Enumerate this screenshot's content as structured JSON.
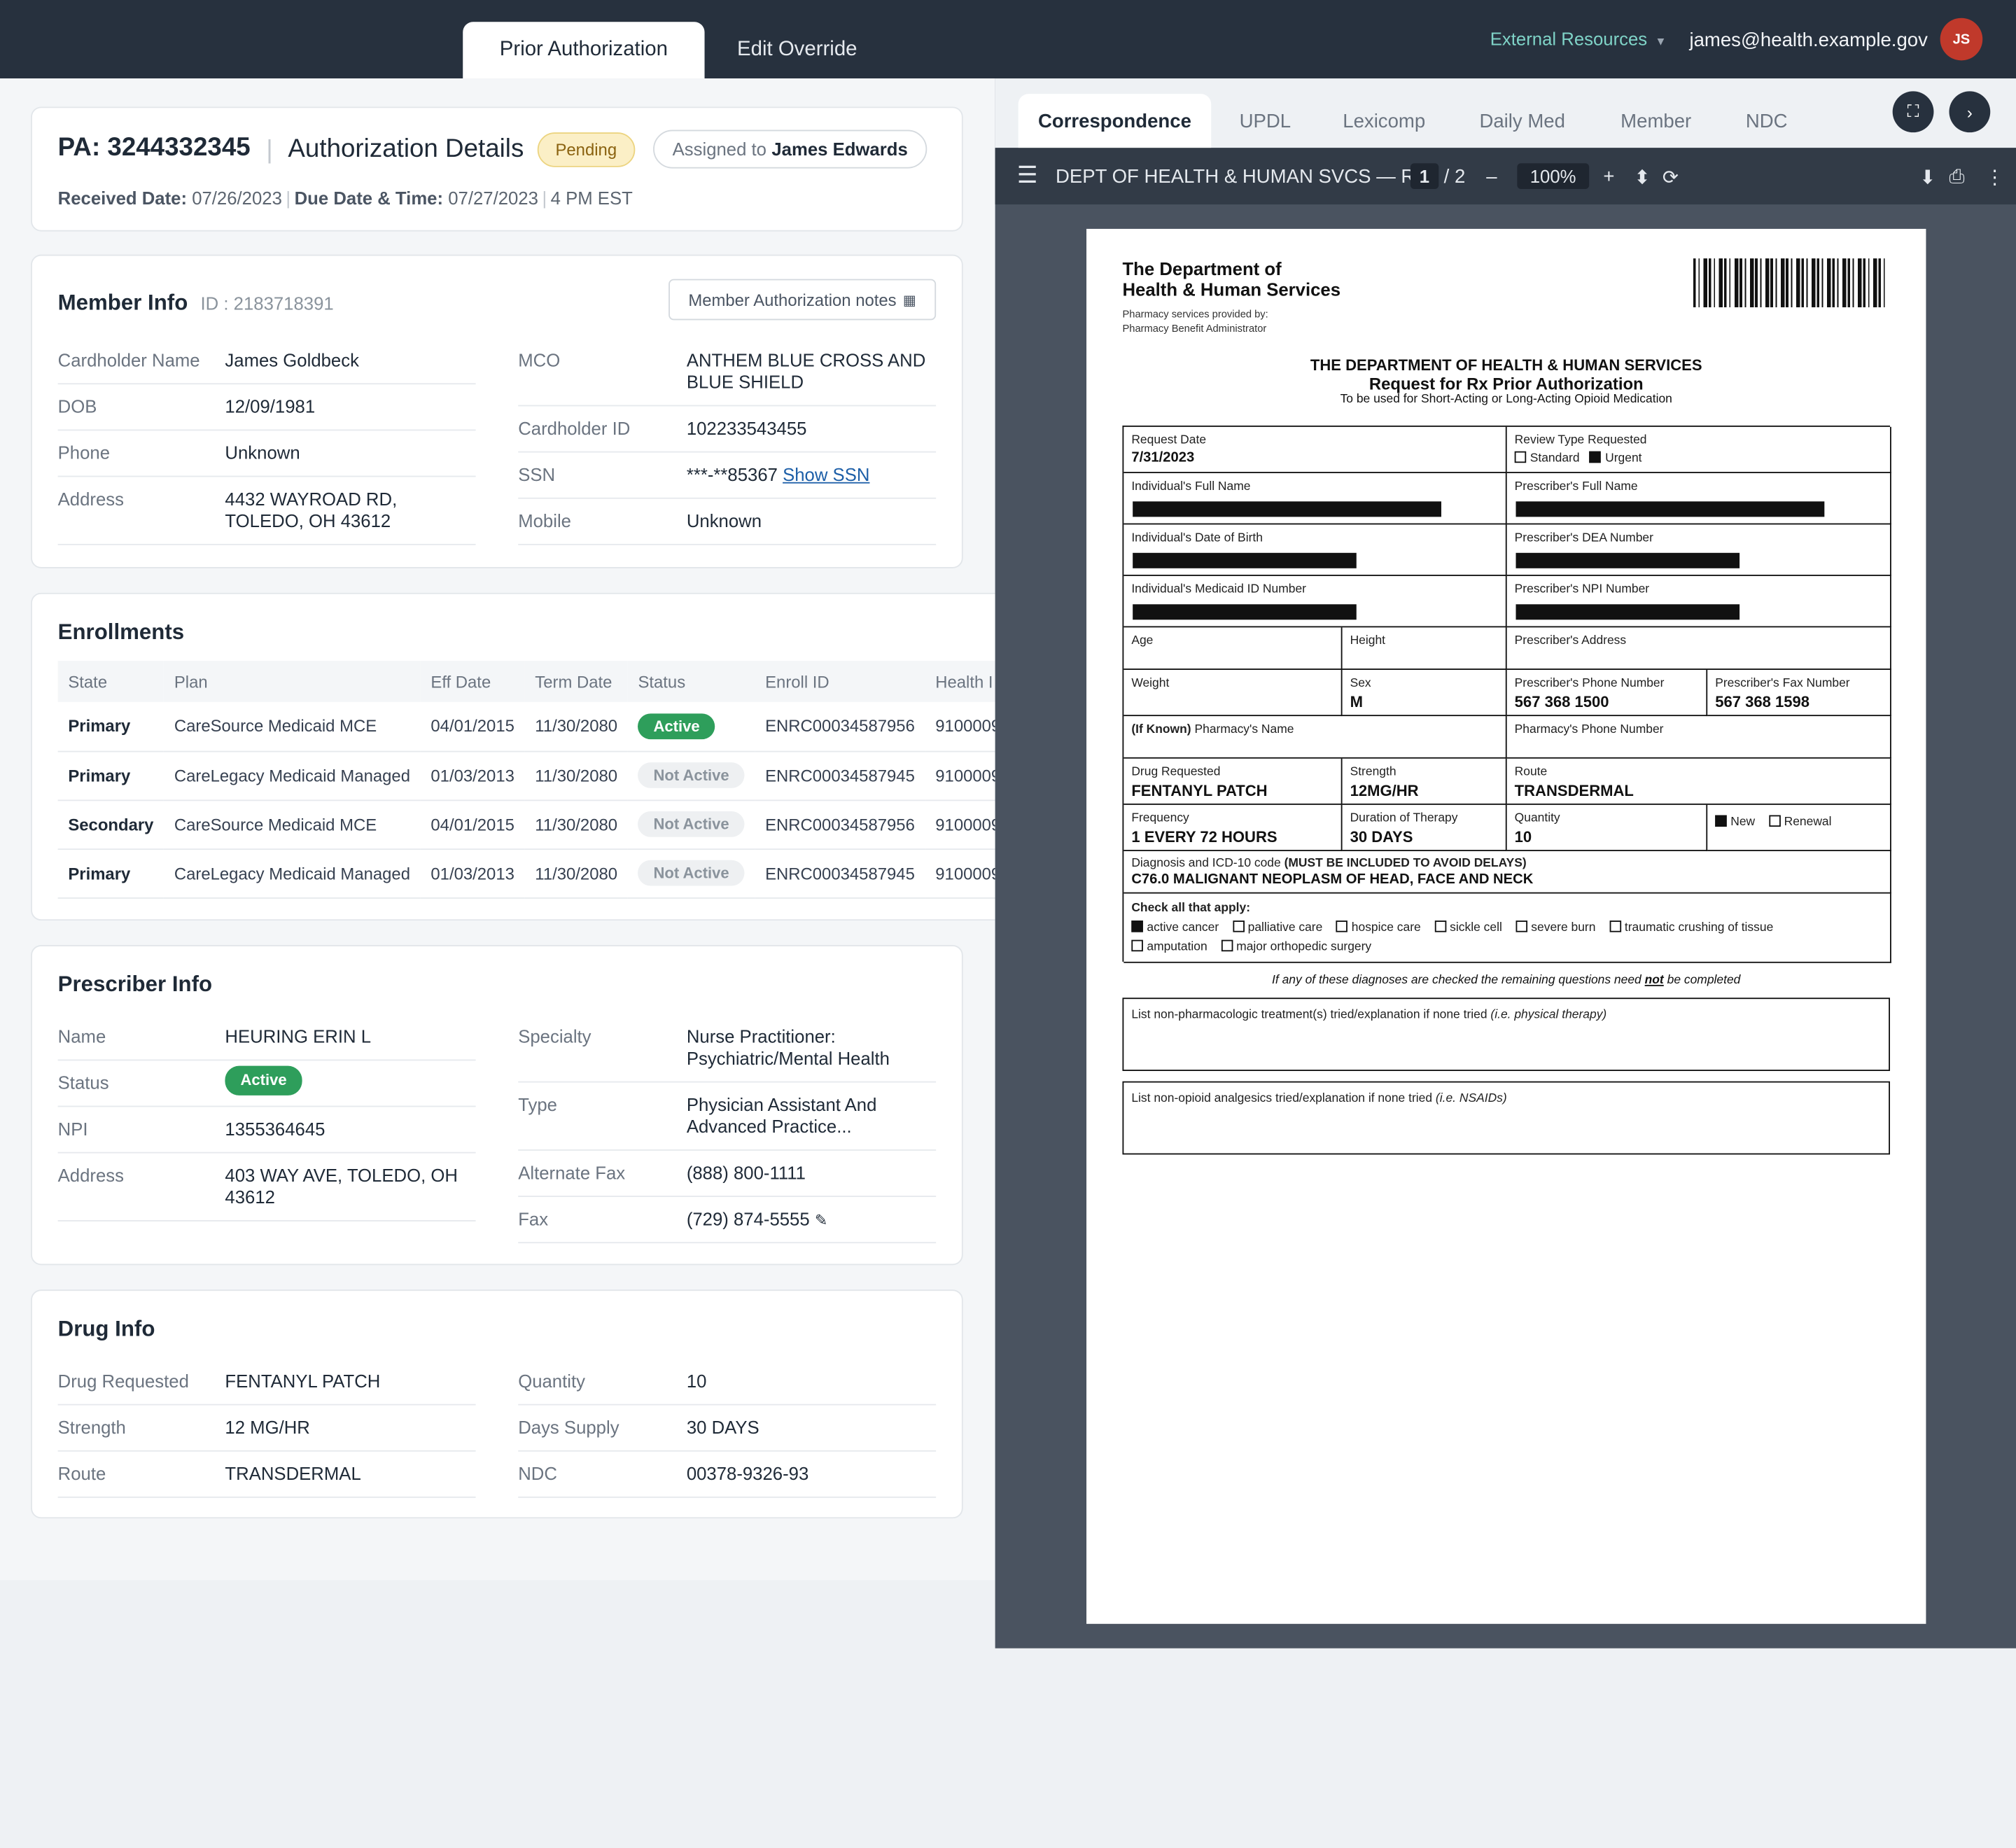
{
  "tabs": {
    "prior_auth": "Prior Authorization",
    "edit_override": "Edit Override"
  },
  "header": {
    "external": "External Resources",
    "email": "james@health.example.gov",
    "avatar": "JS"
  },
  "pa": {
    "id": "PA: 3244332345",
    "details": "Authorization Details",
    "status": "Pending",
    "assigned_prefix": "Assigned to",
    "assigned_name": "James Edwards",
    "received_label": "Received Date:",
    "received": "07/26/2023",
    "due_label": "Due Date & Time:",
    "due": "07/27/2023",
    "due_time": "4 PM EST"
  },
  "member": {
    "title": "Member Info",
    "id": "ID : 2183718391",
    "notes_btn": "Member Authorization notes",
    "left": [
      {
        "label": "Cardholder Name",
        "value": "James Goldbeck"
      },
      {
        "label": "DOB",
        "value": "12/09/1981"
      },
      {
        "label": "Phone",
        "value": "Unknown"
      },
      {
        "label": "Address",
        "value": "4432 WAYROAD RD, TOLEDO, OH 43612"
      }
    ],
    "right": [
      {
        "label": "MCO",
        "value": "ANTHEM BLUE CROSS AND BLUE SHIELD"
      },
      {
        "label": "Cardholder ID",
        "value": "102233543455"
      },
      {
        "label": "SSN",
        "value": "***-**85367",
        "link": "Show SSN"
      },
      {
        "label": "Mobile",
        "value": "Unknown"
      }
    ]
  },
  "enrollments": {
    "title": "Enrollments",
    "headers": [
      "State",
      "Plan",
      "Eff Date",
      "Term Date",
      "Status",
      "Enroll ID",
      "Health I"
    ],
    "rows": [
      {
        "state": "Primary",
        "plan": "CareSource Medicaid MCE",
        "eff": "04/01/2015",
        "term": "11/30/2080",
        "status": "Active",
        "enroll": "ENRC00034587956",
        "health": "9100009"
      },
      {
        "state": "Primary",
        "plan": "CareLegacy Medicaid Managed",
        "eff": "01/03/2013",
        "term": "11/30/2080",
        "status": "Not Active",
        "enroll": "ENRC00034587945",
        "health": "9100009"
      },
      {
        "state": "Secondary",
        "plan": "CareSource Medicaid MCE",
        "eff": "04/01/2015",
        "term": "11/30/2080",
        "status": "Not Active",
        "enroll": "ENRC00034587956",
        "health": "9100009"
      },
      {
        "state": "Primary",
        "plan": "CareLegacy Medicaid Managed",
        "eff": "01/03/2013",
        "term": "11/30/2080",
        "status": "Not Active",
        "enroll": "ENRC00034587945",
        "health": "9100009"
      }
    ]
  },
  "prescriber": {
    "title": "Prescriber Info",
    "left": [
      {
        "label": "Name",
        "value": "HEURING ERIN L"
      },
      {
        "label": "Status",
        "value": "Active"
      },
      {
        "label": "NPI",
        "value": "1355364645"
      },
      {
        "label": "Address",
        "value": "403 WAY AVE, TOLEDO, OH 43612"
      }
    ],
    "right": [
      {
        "label": "Specialty",
        "value": "Nurse Practitioner: Psychiatric/Mental Health"
      },
      {
        "label": "Type",
        "value": "Physician Assistant And Advanced Practice..."
      },
      {
        "label": "Alternate Fax",
        "value": "(888) 800-1111"
      },
      {
        "label": "Fax",
        "value": "(729) 874-5555"
      }
    ]
  },
  "drug": {
    "title": "Drug Info",
    "left": [
      {
        "label": "Drug Requested",
        "value": "FENTANYL PATCH"
      },
      {
        "label": "Strength",
        "value": "12 MG/HR"
      },
      {
        "label": "Route",
        "value": "TRANSDERMAL"
      }
    ],
    "right": [
      {
        "label": "Quantity",
        "value": "10"
      },
      {
        "label": "Days Supply",
        "value": "30 DAYS"
      },
      {
        "label": "NDC",
        "value": "00378-9326-93"
      }
    ]
  },
  "viewer": {
    "tabs": [
      "Correspondence",
      "UPDL",
      "Lexicomp",
      "Daily Med",
      "Member",
      "NDC"
    ],
    "doc_title": "DEPT OF HEALTH & HUMAN SVCS — R...",
    "page": "1",
    "pages": "/ 2",
    "zoom": "100%"
  },
  "form": {
    "org1": "The Department of",
    "org2": "Health & Human Services",
    "sub1": "Pharmacy services provided by:",
    "sub2": "Pharmacy Benefit Administrator",
    "h1": "THE DEPARTMENT OF HEALTH & HUMAN SERVICES",
    "h2": "Request for Rx Prior Authorization",
    "h3": "To be used for Short-Acting or Long-Acting Opioid Medication",
    "request_date_l": "Request Date",
    "request_date": "7/31/2023",
    "review_type_l": "Review Type Requested",
    "standard": "Standard",
    "urgent": "Urgent",
    "ind_name_l": "Individual's Full Name",
    "pres_name_l": "Prescriber's Full Name",
    "ind_dob_l": "Individual's Date of Birth",
    "pres_dea_l": "Prescriber's DEA Number",
    "ind_mid_l": "Individual's Medicaid ID Number",
    "pres_npi_l": "Prescriber's NPI Number",
    "age_l": "Age",
    "height_l": "Height",
    "pres_addr_l": "Prescriber's Address",
    "weight_l": "Weight",
    "sex_l": "Sex",
    "sex": "M",
    "pres_phone_l": "Prescriber's Phone Number",
    "pres_phone": "567 368 1500",
    "pres_fax_l": "Prescriber's Fax Number",
    "pres_fax": "567 368 1598",
    "if_known": "(If Known)",
    "pharm_name_l": "Pharmacy's Name",
    "pharm_phone_l": "Pharmacy's Phone Number",
    "drug_l": "Drug Requested",
    "drug": "FENTANYL PATCH",
    "strength_l": "Strength",
    "strength": "12MG/HR",
    "route_l": "Route",
    "route": "TRANSDERMAL",
    "freq_l": "Frequency",
    "freq": "1 EVERY 72 HOURS",
    "dur_l": "Duration of Therapy",
    "dur": "30 DAYS",
    "qty_l": "Quantity",
    "qty": "10",
    "new": "New",
    "renewal": "Renewal",
    "dx_l": "Diagnosis and ICD-10 code",
    "dx_must": "(MUST BE INCLUDED TO AVOID DELAYS)",
    "dx": "C76.0   MALIGNANT NEOPLASM OF HEAD, FACE AND NECK",
    "check_l": "Check all that apply:",
    "checks": [
      "active cancer",
      "palliative care",
      "hospice care",
      "sickle cell",
      "severe burn",
      "traumatic crushing of tissue",
      "amputation",
      "major orthopedic surgery"
    ],
    "note_a": "If any of these diagnoses are checked the remaining questions need",
    "note_b": "not",
    "note_c": "be completed",
    "q1": "List non-pharmacologic treatment(s) tried/explanation if none tried",
    "q1i": "(i.e. physical therapy)",
    "q2": "List non-opioid analgesics tried/explanation if none tried",
    "q2i": "(i.e. NSAIDs)"
  }
}
